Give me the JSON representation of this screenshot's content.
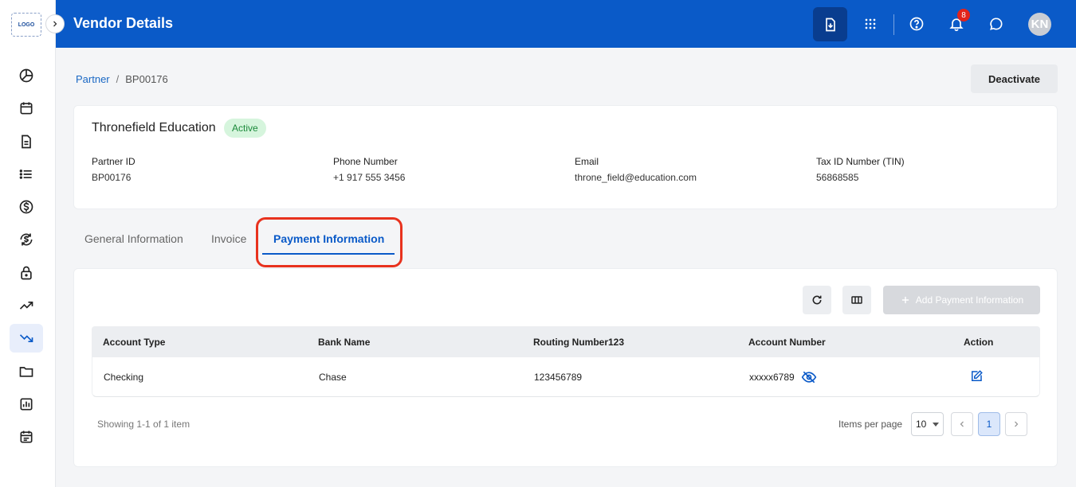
{
  "header": {
    "title": "Vendor Details",
    "notification_count": "8",
    "avatar_initials": "KN"
  },
  "sidebar": {
    "logo_text": "LOGO",
    "items": [
      {
        "icon": "pie-chart-icon"
      },
      {
        "icon": "calendar-icon"
      },
      {
        "icon": "document-icon"
      },
      {
        "icon": "list-icon"
      },
      {
        "icon": "dollar-icon"
      },
      {
        "icon": "dollar-exchange-icon"
      },
      {
        "icon": "lock-icon"
      },
      {
        "icon": "trend-up-icon"
      },
      {
        "icon": "trend-down-icon",
        "active": true
      },
      {
        "icon": "folder-icon"
      },
      {
        "icon": "bar-chart-icon"
      },
      {
        "icon": "schedule-icon"
      }
    ]
  },
  "breadcrumb": {
    "parent": "Partner",
    "current": "BP00176"
  },
  "actions": {
    "deactivate_label": "Deactivate"
  },
  "vendor": {
    "name": "Thronefield Education",
    "status": "Active",
    "fields": {
      "partner_id_label": "Partner ID",
      "partner_id": "BP00176",
      "phone_label": "Phone Number",
      "phone": "+1 917 555 3456",
      "email_label": "Email",
      "email": "throne_field@education.com",
      "tin_label": "Tax ID Number (TIN)",
      "tin": "56868585"
    }
  },
  "tabs": [
    {
      "label": "General Information"
    },
    {
      "label": "Invoice"
    },
    {
      "label": "Payment Information",
      "active": true
    }
  ],
  "payment": {
    "add_label": "Add Payment Information",
    "columns": [
      "Account Type",
      "Bank Name",
      "Routing Number123",
      "Account Number",
      "Action"
    ],
    "rows": [
      {
        "account_type": "Checking",
        "bank_name": "Chase",
        "routing_number": "123456789",
        "account_number": "xxxxx6789"
      }
    ],
    "footer": {
      "showing": "Showing 1-1 of 1 item",
      "items_per_page_label": "Items per page",
      "items_per_page": "10",
      "current_page": "1"
    }
  },
  "colors": {
    "header_bg": "#0a5ac8",
    "accent": "#0a5ac8",
    "status_bg": "#d6f5dd",
    "status_text": "#1b8a3a",
    "highlight": "#e8321e"
  }
}
